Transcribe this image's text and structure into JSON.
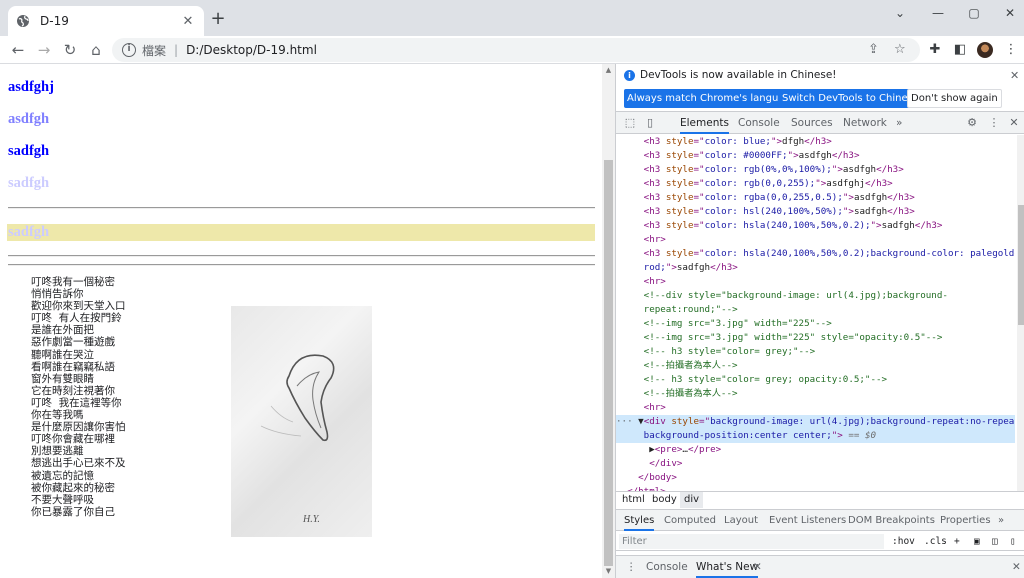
{
  "browser": {
    "tab_title": "D-19",
    "tab_close": "✕",
    "new_tab": "+",
    "win_min": "⌄",
    "win_min2": "—",
    "win_max": "▢",
    "win_close": "✕",
    "scheme_label": "檔案",
    "separator": "|",
    "url": "D:/Desktop/D-19.html"
  },
  "page": {
    "headings": [
      {
        "text": "asdfghj",
        "color": "#0000ff"
      },
      {
        "text": "asdfgh",
        "color": "#8080ff"
      },
      {
        "text": "sadfgh",
        "color": "#0000ff"
      },
      {
        "text": "sadfgh",
        "color": "#ccccff"
      }
    ],
    "highlight_heading": {
      "text": "sadfgh",
      "color": "#ccccff",
      "background": "#eee8aa"
    },
    "poem": [
      "叮咚我有一個秘密",
      "悄悄告訴你",
      "歡迎你來到天堂入口",
      "叮咚  有人在按門鈴",
      "是誰在外面把",
      "惡作劇當一種遊戲",
      "聽啊誰在哭泣",
      "看啊誰在竊竊私語",
      "窗外有雙眼睛",
      "它在時刻注視著你",
      "叮咚  我在這裡等你",
      "你在等我嗎",
      "是什麼原因讓你害怕",
      "叮咚你會藏在哪裡",
      "別想要逃離",
      "想逃出手心已來不及",
      "被遺忘的記憶",
      "被你藏起來的秘密",
      "不要大聲呼吸",
      "你已暴露了你自己"
    ],
    "sketch_signature": "H.Y."
  },
  "devtools": {
    "notice": {
      "message": "DevTools is now available in Chinese!",
      "btn_match": "Always match Chrome's language",
      "btn_switch": "Switch DevTools to Chinese",
      "btn_dismiss": "Don't show again"
    },
    "tabs": [
      "Elements",
      "Console",
      "Sources",
      "Network"
    ],
    "more": "»",
    "breadcrumbs": [
      "html",
      "body",
      "div"
    ],
    "styles_tabs": [
      "Styles",
      "Computed",
      "Layout",
      "Event Listeners",
      "DOM Breakpoints",
      "Properties"
    ],
    "filter_placeholder": "Filter",
    "hov": ":hov",
    "cls": ".cls",
    "drawer_tabs": [
      "Console",
      "What's New"
    ]
  }
}
